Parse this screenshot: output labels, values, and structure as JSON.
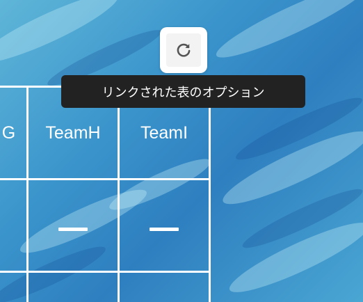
{
  "table": {
    "headers": [
      "G",
      "TeamH",
      "TeamI"
    ],
    "row2": [
      "",
      "—",
      "—"
    ]
  },
  "toolbar": {
    "refresh_icon": "refresh-icon"
  },
  "tooltip": {
    "text": "リンクされた表のオプション"
  }
}
